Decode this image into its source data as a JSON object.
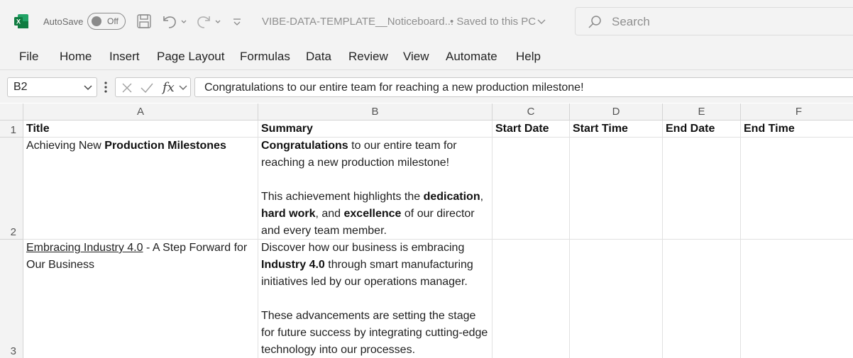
{
  "title_bar": {
    "autosave_label": "AutoSave",
    "autosave_state": "Off",
    "document_name": "VIBE-DATA-TEMPLATE__Noticeboard...",
    "save_status": "• Saved to this PC",
    "search_placeholder": "Search"
  },
  "ribbon_tabs": [
    "File",
    "Home",
    "Insert",
    "Page Layout",
    "Formulas",
    "Data",
    "Review",
    "View",
    "Automate",
    "Help"
  ],
  "formula_bar": {
    "name_box": "B2",
    "content": "Congratulations to our entire team for reaching a new production milestone!"
  },
  "columns": [
    "A",
    "B",
    "C",
    "D",
    "E",
    "F"
  ],
  "row_numbers": [
    "1",
    "2",
    "3"
  ],
  "header_row": {
    "a": "Title",
    "b": "Summary",
    "c": "Start Date",
    "d": "Start Time",
    "e": "End Date",
    "f": "End Time"
  },
  "rows": [
    {
      "title_plain": "Achieving New ",
      "title_bold": "Production Milestones",
      "summary": {
        "p1_bold": "Congratulations",
        "p1_rest": " to our entire team for reaching a new production milestone!",
        "p2_start": "This achievement highlights the ",
        "p2_bold1": "dedication",
        "p2_mid1": ", ",
        "p2_bold2": "hard work",
        "p2_mid2": ", and ",
        "p2_bold3": "excellence",
        "p2_end": " of our director and every team member."
      }
    },
    {
      "title_link": "Embracing Industry 4.0",
      "title_rest": " - A Step Forward for Our Business",
      "summary": {
        "p1_start": "Discover how our business is embracing ",
        "p1_bold": "Industry 4.0",
        "p1_end": " through smart manufacturing initiatives led by our operations manager.",
        "p2": "These advancements are setting the stage for future success by integrating cutting-edge technology into our processes."
      }
    }
  ],
  "colors": {
    "excel_green": "#107c41",
    "chrome_bg": "#f3f3f3",
    "gridline": "#e1e1e1"
  }
}
